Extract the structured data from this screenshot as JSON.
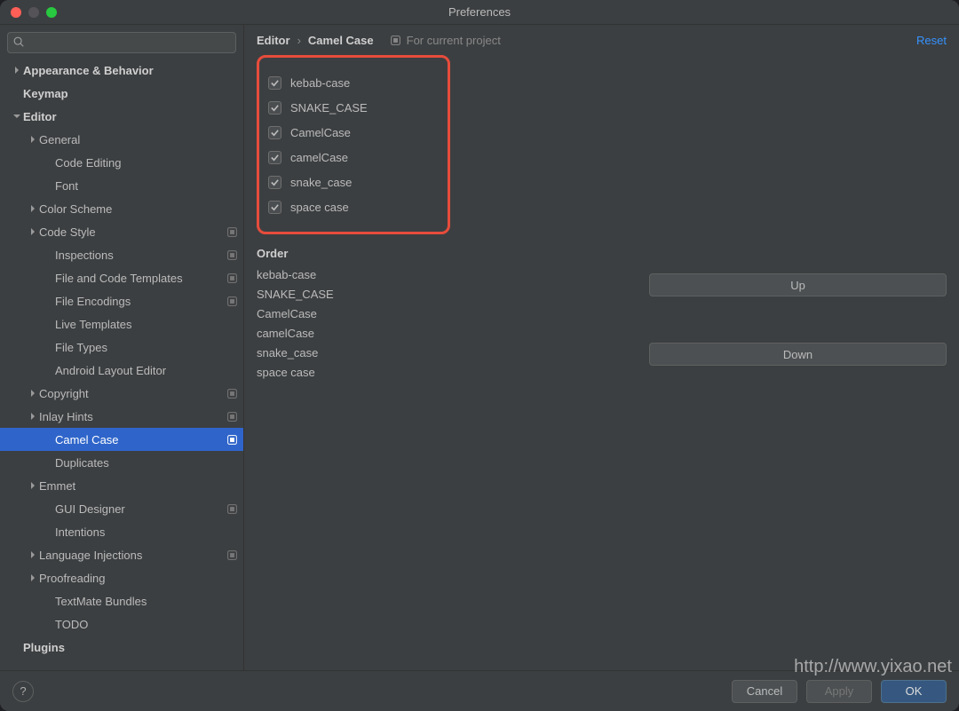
{
  "window": {
    "title": "Preferences"
  },
  "search": {
    "placeholder": ""
  },
  "sidebar": {
    "items": [
      {
        "label": "Appearance & Behavior",
        "depth": 0,
        "arrow": "right",
        "bold": true
      },
      {
        "label": "Keymap",
        "depth": 0,
        "arrow": "",
        "bold": true
      },
      {
        "label": "Editor",
        "depth": 0,
        "arrow": "down",
        "bold": true
      },
      {
        "label": "General",
        "depth": 1,
        "arrow": "right"
      },
      {
        "label": "Code Editing",
        "depth": 2,
        "arrow": ""
      },
      {
        "label": "Font",
        "depth": 2,
        "arrow": ""
      },
      {
        "label": "Color Scheme",
        "depth": 1,
        "arrow": "right"
      },
      {
        "label": "Code Style",
        "depth": 1,
        "arrow": "right",
        "badge": true
      },
      {
        "label": "Inspections",
        "depth": 2,
        "arrow": "",
        "badge": true
      },
      {
        "label": "File and Code Templates",
        "depth": 2,
        "arrow": "",
        "badge": true
      },
      {
        "label": "File Encodings",
        "depth": 2,
        "arrow": "",
        "badge": true
      },
      {
        "label": "Live Templates",
        "depth": 2,
        "arrow": ""
      },
      {
        "label": "File Types",
        "depth": 2,
        "arrow": ""
      },
      {
        "label": "Android Layout Editor",
        "depth": 2,
        "arrow": ""
      },
      {
        "label": "Copyright",
        "depth": 1,
        "arrow": "right",
        "badge": true
      },
      {
        "label": "Inlay Hints",
        "depth": 1,
        "arrow": "right",
        "badge": true
      },
      {
        "label": "Camel Case",
        "depth": 2,
        "arrow": "",
        "badge": true,
        "selected": true
      },
      {
        "label": "Duplicates",
        "depth": 2,
        "arrow": ""
      },
      {
        "label": "Emmet",
        "depth": 1,
        "arrow": "right"
      },
      {
        "label": "GUI Designer",
        "depth": 2,
        "arrow": "",
        "badge": true
      },
      {
        "label": "Intentions",
        "depth": 2,
        "arrow": ""
      },
      {
        "label": "Language Injections",
        "depth": 1,
        "arrow": "right",
        "badge": true
      },
      {
        "label": "Proofreading",
        "depth": 1,
        "arrow": "right"
      },
      {
        "label": "TextMate Bundles",
        "depth": 2,
        "arrow": ""
      },
      {
        "label": "TODO",
        "depth": 2,
        "arrow": ""
      },
      {
        "label": "Plugins",
        "depth": 0,
        "arrow": "",
        "bold": true
      }
    ]
  },
  "breadcrumb": {
    "root": "Editor",
    "leaf": "Camel Case",
    "for_project": "For current project"
  },
  "reset_label": "Reset",
  "checkboxes": [
    {
      "label": "kebab-case",
      "checked": true
    },
    {
      "label": "SNAKE_CASE",
      "checked": true
    },
    {
      "label": "CamelCase",
      "checked": true
    },
    {
      "label": "camelCase",
      "checked": true
    },
    {
      "label": "snake_case",
      "checked": true
    },
    {
      "label": "space case",
      "checked": true
    }
  ],
  "order": {
    "header": "Order",
    "items": [
      "kebab-case",
      "SNAKE_CASE",
      "CamelCase",
      "camelCase",
      "snake_case",
      "space case"
    ],
    "up": "Up",
    "down": "Down"
  },
  "footer": {
    "cancel": "Cancel",
    "apply": "Apply",
    "ok": "OK"
  },
  "watermark": "http://www.yixao.net"
}
